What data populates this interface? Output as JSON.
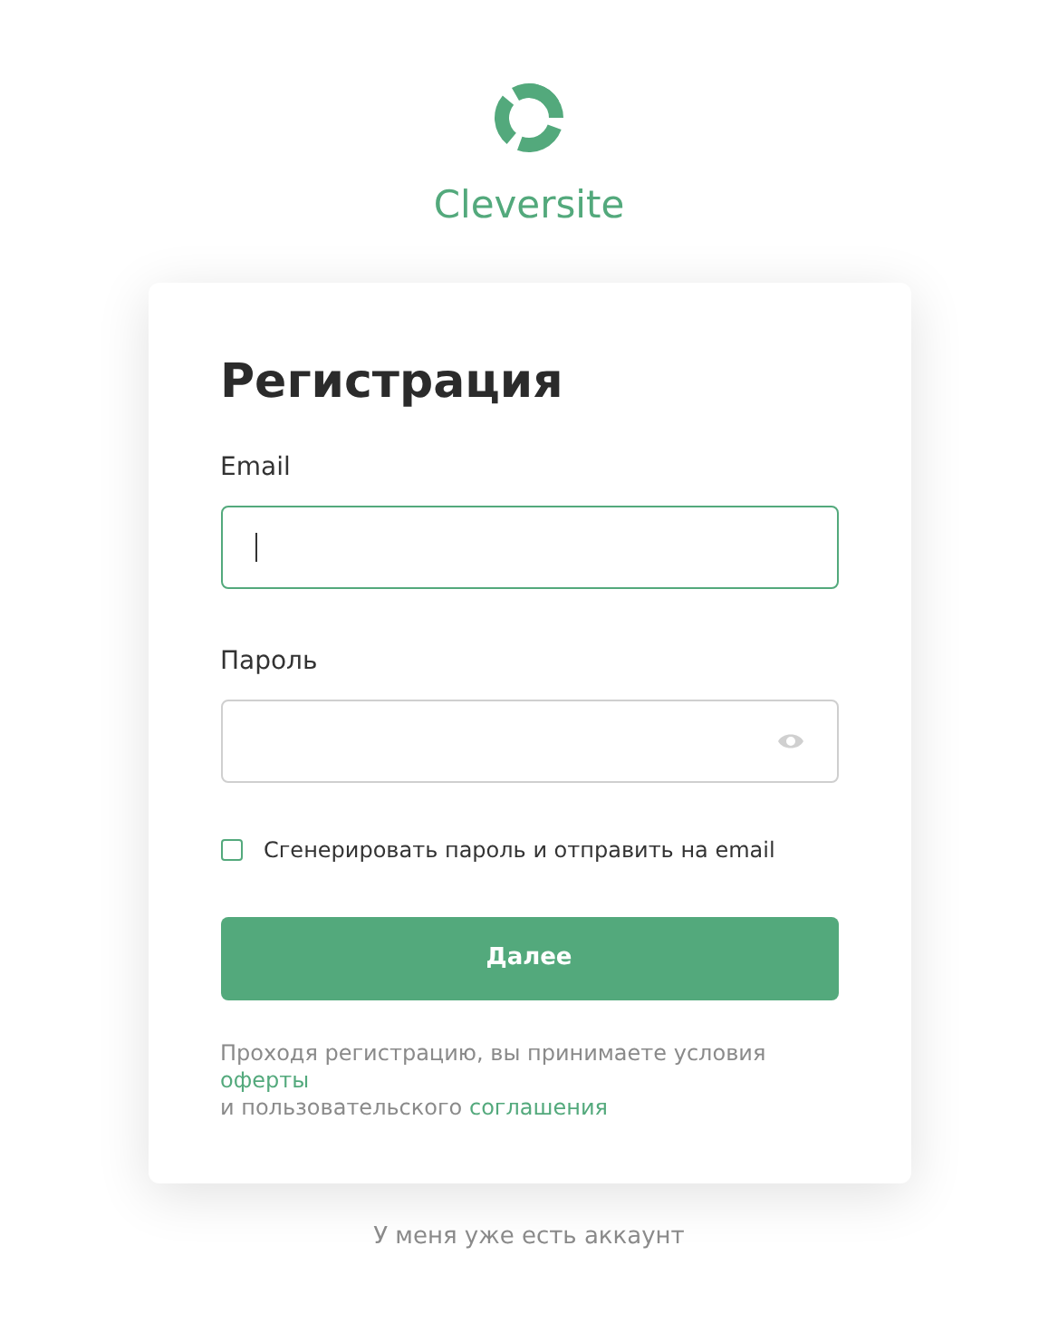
{
  "brand": {
    "name": "Cleversite"
  },
  "form": {
    "title": "Регистрация",
    "fields": [
      {
        "kind": "email",
        "label": "Email",
        "focused": true
      },
      {
        "kind": "password",
        "label": "Пароль",
        "focused": false
      }
    ],
    "generate_password": {
      "label": "Сгенерировать пароль и отправить на email",
      "checked": false
    },
    "submit": "Далее",
    "terms": {
      "text_before": "Проходя регистрацию, вы принимаете условия ",
      "link_offer": "оферты",
      "text_middle": "и пользовательского ",
      "link_agreement": "соглашения"
    }
  },
  "login_link": "У меня уже есть аккаунт"
}
